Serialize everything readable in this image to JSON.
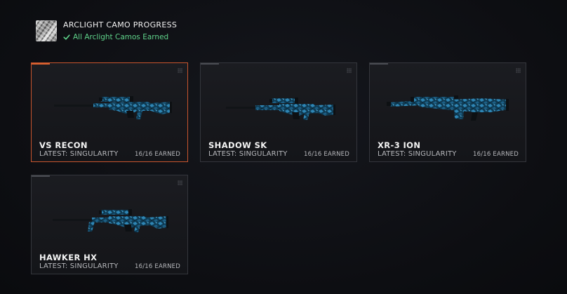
{
  "header": {
    "title": "ARCLIGHT CAMO PROGRESS",
    "status": "All Arclight Camos Earned",
    "icon": "camo-swatch-icon",
    "status_color": "#5fd38a"
  },
  "colors": {
    "selected_border": "#c8552e",
    "camo_base": "#0f3a52",
    "camo_highlight": "#2f86b5"
  },
  "cards": [
    {
      "name": "VS RECON",
      "latest": "LATEST: SINGULARITY",
      "earned": "16/16 EARNED",
      "selected": true,
      "icon": "sniper-rifle-icon"
    },
    {
      "name": "SHADOW SK",
      "latest": "LATEST: SINGULARITY",
      "earned": "16/16 EARNED",
      "selected": false,
      "icon": "sniper-rifle-icon"
    },
    {
      "name": "XR-3 ION",
      "latest": "LATEST: SINGULARITY",
      "earned": "16/16 EARNED",
      "selected": false,
      "icon": "sniper-rifle-icon"
    },
    {
      "name": "HAWKER HX",
      "latest": "LATEST: SINGULARITY",
      "earned": "16/16 EARNED",
      "selected": false,
      "icon": "sniper-rifle-icon"
    }
  ]
}
